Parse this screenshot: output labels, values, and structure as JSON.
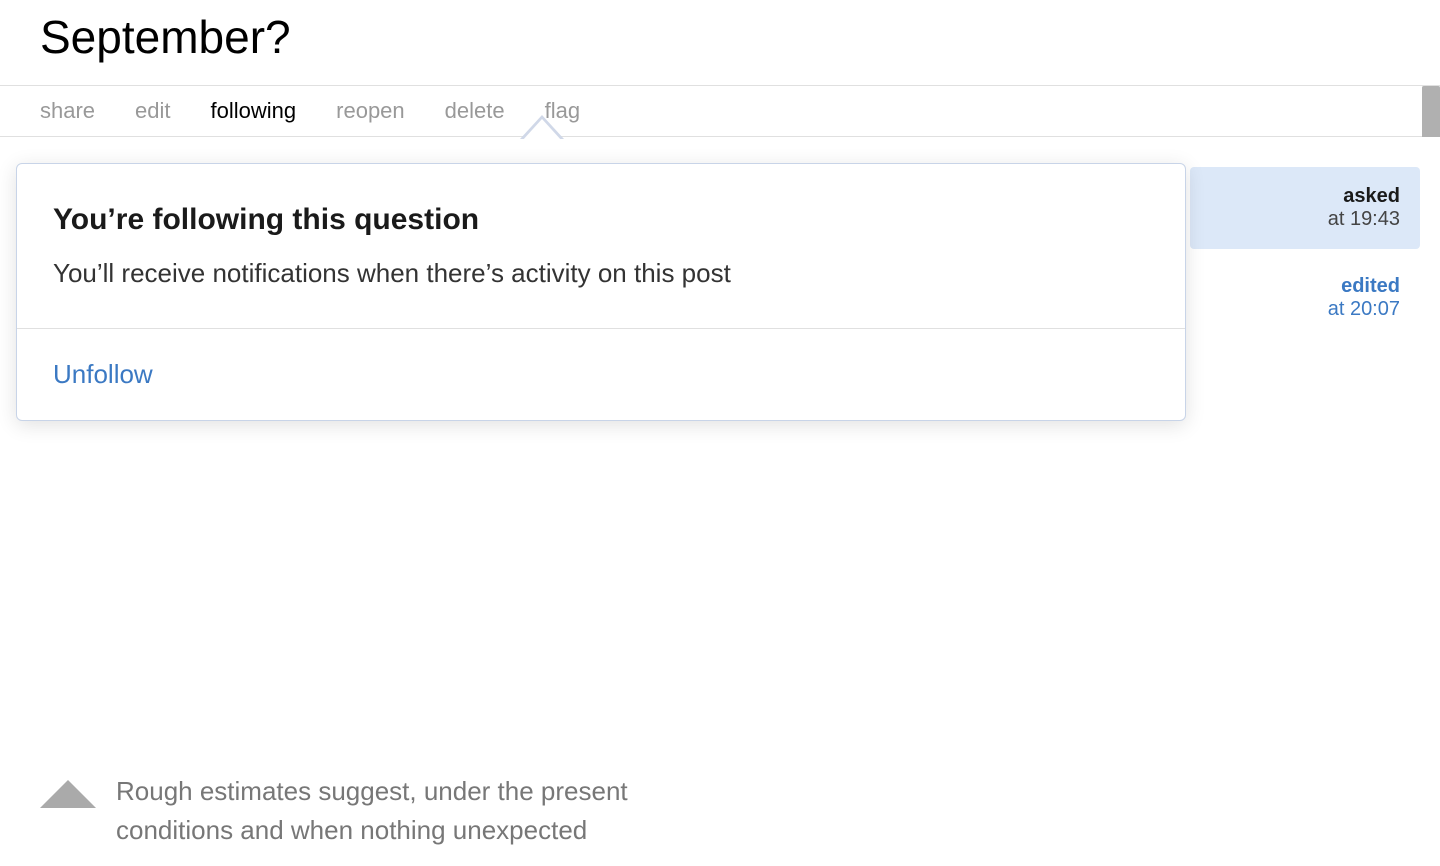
{
  "page": {
    "title": "September?",
    "title_prefix": ""
  },
  "action_bar": {
    "items": [
      {
        "id": "share",
        "label": "share",
        "active": false
      },
      {
        "id": "edit",
        "label": "edit",
        "active": false
      },
      {
        "id": "following",
        "label": "following",
        "active": true
      },
      {
        "id": "reopen",
        "label": "reopen",
        "active": false
      },
      {
        "id": "delete",
        "label": "delete",
        "active": false
      },
      {
        "id": "flag",
        "label": "flag",
        "active": false
      }
    ]
  },
  "tooltip": {
    "title": "You’re following this question",
    "description": "You’ll receive notifications when there’s activity on this post",
    "unfollow_label": "Unfollow"
  },
  "sidebar": {
    "asked_label": "asked",
    "asked_time": "at 19:43",
    "edited_label": "edited",
    "edited_time": "at 20:07"
  },
  "bottom": {
    "line1": "Rough estimates suggest, under the present",
    "line2": "conditions and when nothing unexpected"
  },
  "colors": {
    "active_text": "#000000",
    "inactive_text": "#999999",
    "accent_blue": "#3b79c3",
    "tooltip_border": "#c8d4e8",
    "asked_bg": "#dce8f8"
  }
}
